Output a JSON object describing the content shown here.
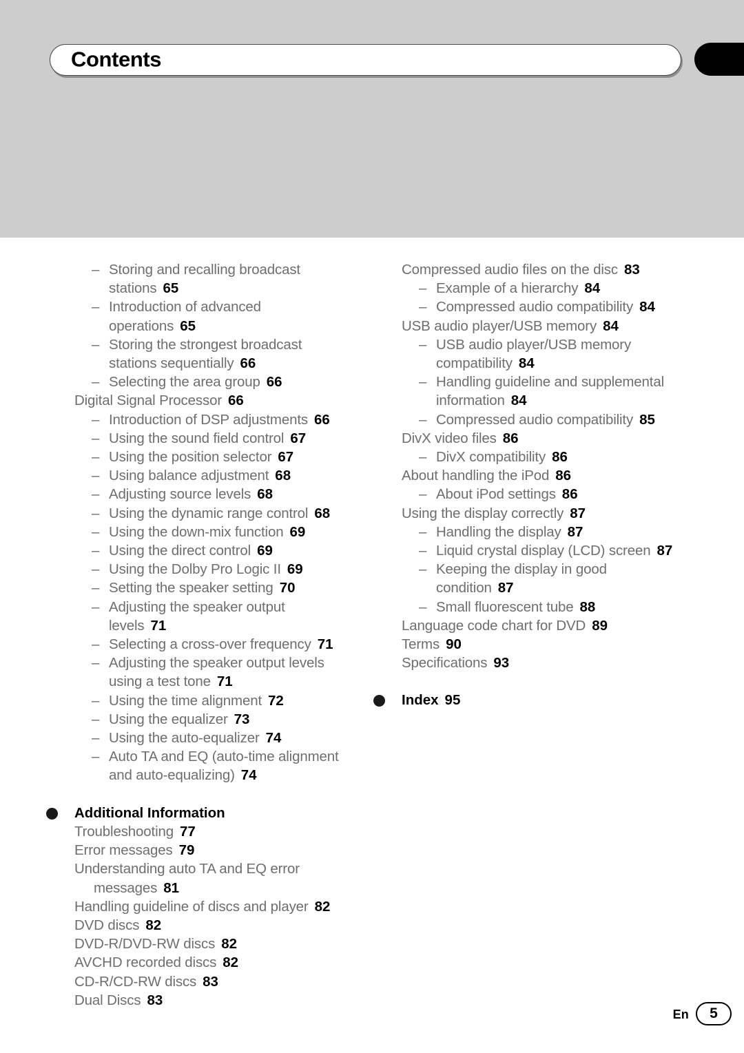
{
  "page": {
    "title": "Contents",
    "language_code": "En",
    "page_number": "5"
  },
  "left_column": [
    {
      "level": 2,
      "text": "Storing and recalling broadcast",
      "page": ""
    },
    {
      "level": 2,
      "cont": true,
      "text": "stations",
      "page": "65"
    },
    {
      "level": 2,
      "text": "Introduction of advanced",
      "page": ""
    },
    {
      "level": 2,
      "cont": true,
      "text": "operations",
      "page": "65"
    },
    {
      "level": 2,
      "text": "Storing the strongest broadcast",
      "page": ""
    },
    {
      "level": 2,
      "cont": true,
      "text": "stations sequentially",
      "page": "66"
    },
    {
      "level": 2,
      "text": "Selecting the area group",
      "page": "66"
    },
    {
      "level": 1,
      "text": "Digital Signal Processor",
      "page": "66"
    },
    {
      "level": 2,
      "text": "Introduction of DSP adjustments",
      "page": "66"
    },
    {
      "level": 2,
      "text": "Using the sound field control",
      "page": "67"
    },
    {
      "level": 2,
      "text": "Using the position selector",
      "page": "67"
    },
    {
      "level": 2,
      "text": "Using balance adjustment",
      "page": "68"
    },
    {
      "level": 2,
      "text": "Adjusting source levels",
      "page": "68"
    },
    {
      "level": 2,
      "text": "Using the dynamic range control",
      "page": "68"
    },
    {
      "level": 2,
      "text": "Using the down-mix function",
      "page": "69"
    },
    {
      "level": 2,
      "text": "Using the direct control",
      "page": "69"
    },
    {
      "level": 2,
      "text": "Using the Dolby Pro Logic II",
      "page": "69"
    },
    {
      "level": 2,
      "text": "Setting the speaker setting",
      "page": "70"
    },
    {
      "level": 2,
      "text": "Adjusting the speaker output",
      "page": ""
    },
    {
      "level": 2,
      "cont": true,
      "text": "levels",
      "page": "71"
    },
    {
      "level": 2,
      "text": "Selecting a cross-over frequency",
      "page": "71"
    },
    {
      "level": 2,
      "text": "Adjusting the speaker output levels",
      "page": ""
    },
    {
      "level": 2,
      "cont": true,
      "text": "using a test tone",
      "page": "71"
    },
    {
      "level": 2,
      "text": "Using the time alignment",
      "page": "72"
    },
    {
      "level": 2,
      "text": "Using the equalizer",
      "page": "73"
    },
    {
      "level": 2,
      "text": "Using the auto-equalizer",
      "page": "74"
    },
    {
      "level": 2,
      "text": "Auto TA and EQ (auto-time alignment",
      "page": ""
    },
    {
      "level": 2,
      "cont": true,
      "text": "and auto-equalizing)",
      "page": "74"
    }
  ],
  "left_section": {
    "heading": "Additional Information",
    "items": [
      {
        "level": 1,
        "text": "Troubleshooting",
        "page": "77"
      },
      {
        "level": 1,
        "text": "Error messages",
        "page": "79"
      },
      {
        "level": 1,
        "text": "Understanding auto TA and EQ error",
        "page": ""
      },
      {
        "level": 1,
        "cont": true,
        "text": "messages",
        "page": "81"
      },
      {
        "level": 1,
        "text": "Handling guideline of discs and player",
        "page": "82"
      },
      {
        "level": 1,
        "text": "DVD discs",
        "page": "82"
      },
      {
        "level": 1,
        "text": "DVD-R/DVD-RW discs",
        "page": "82"
      },
      {
        "level": 1,
        "text": "AVCHD recorded discs",
        "page": "82"
      },
      {
        "level": 1,
        "text": "CD-R/CD-RW discs",
        "page": "83"
      },
      {
        "level": 1,
        "text": "Dual Discs",
        "page": "83"
      }
    ]
  },
  "right_column": [
    {
      "level": 1,
      "text": "Compressed audio files on the disc",
      "page": "83"
    },
    {
      "level": 2,
      "text": "Example of a hierarchy",
      "page": "84"
    },
    {
      "level": 2,
      "text": "Compressed audio compatibility",
      "page": "84"
    },
    {
      "level": 1,
      "text": "USB audio player/USB memory",
      "page": "84"
    },
    {
      "level": 2,
      "text": "USB audio player/USB memory",
      "page": ""
    },
    {
      "level": 2,
      "cont": true,
      "text": "compatibility",
      "page": "84"
    },
    {
      "level": 2,
      "text": "Handling guideline and supplemental",
      "page": ""
    },
    {
      "level": 2,
      "cont": true,
      "text": "information",
      "page": "84"
    },
    {
      "level": 2,
      "text": "Compressed audio compatibility",
      "page": "85"
    },
    {
      "level": 1,
      "text": "DivX video files",
      "page": "86"
    },
    {
      "level": 2,
      "text": "DivX compatibility",
      "page": "86"
    },
    {
      "level": 1,
      "text": "About handling the iPod",
      "page": "86"
    },
    {
      "level": 2,
      "text": "About iPod settings",
      "page": "86"
    },
    {
      "level": 1,
      "text": "Using the display correctly",
      "page": "87"
    },
    {
      "level": 2,
      "text": "Handling the display",
      "page": "87"
    },
    {
      "level": 2,
      "text": "Liquid crystal display (LCD) screen",
      "page": "87"
    },
    {
      "level": 2,
      "text": "Keeping the display in good",
      "page": ""
    },
    {
      "level": 2,
      "cont": true,
      "text": "condition",
      "page": "87"
    },
    {
      "level": 2,
      "text": "Small fluorescent tube",
      "page": "88"
    },
    {
      "level": 1,
      "text": "Language code chart for DVD",
      "page": "89"
    },
    {
      "level": 1,
      "text": "Terms",
      "page": "90"
    },
    {
      "level": 1,
      "text": "Specifications",
      "page": "93"
    }
  ],
  "right_section": {
    "heading": "Index",
    "page": "95"
  }
}
